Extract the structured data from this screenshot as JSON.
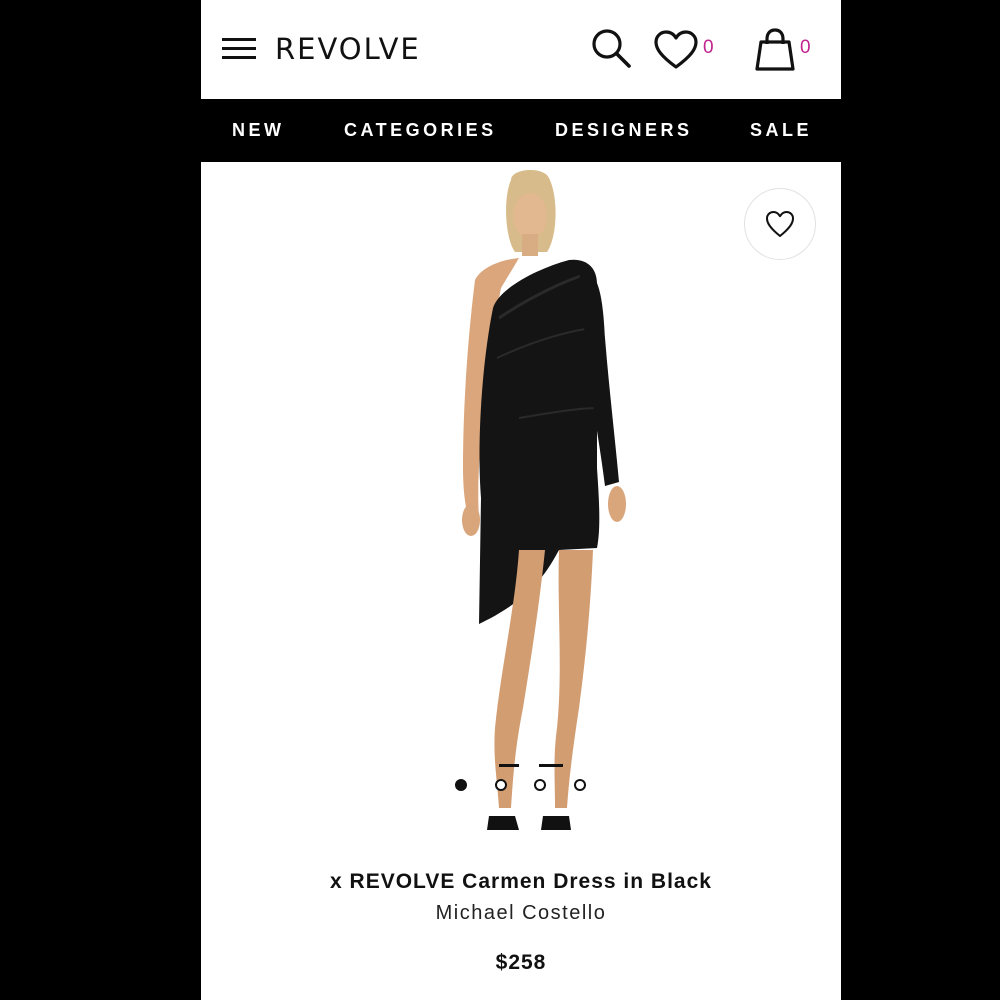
{
  "header": {
    "logo": "REVOLVE",
    "wishlist_count": "0",
    "bag_count": "0",
    "accent_color": "#c1238f"
  },
  "nav": {
    "items": [
      "NEW",
      "CATEGORIES",
      "DESIGNERS",
      "SALE"
    ]
  },
  "gallery": {
    "image": "model-wearing-one-shoulder-black-dress",
    "dots_total": 4,
    "active_dot": 1
  },
  "product": {
    "title": "x REVOLVE Carmen Dress in Black",
    "brand": "Michael Costello",
    "price": "$258"
  },
  "icons": [
    "menu-icon",
    "search-icon",
    "heart-icon",
    "bag-icon",
    "heart-outline-icon"
  ]
}
